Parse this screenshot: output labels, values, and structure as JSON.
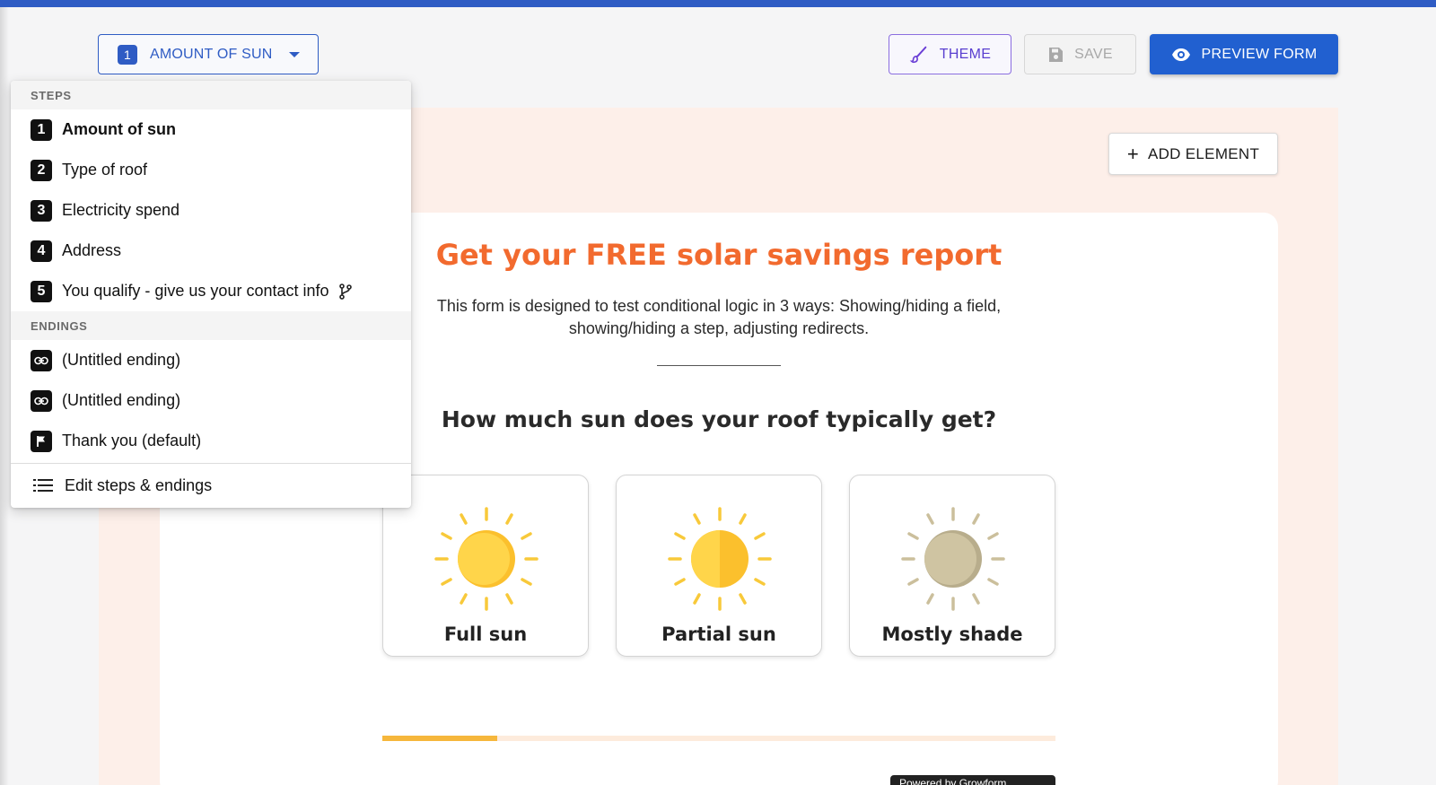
{
  "header": {
    "step_selector": {
      "number": "1",
      "label": "AMOUNT OF SUN"
    },
    "theme_label": "THEME",
    "save_label": "SAVE",
    "preview_label": "PREVIEW FORM",
    "icons": {
      "theme": "brush-icon",
      "save": "floppy-disk-icon",
      "preview": "eye-icon",
      "caret": "caret-down-icon"
    }
  },
  "colors": {
    "brand_blue": "#2f5cc4",
    "title_orange": "#f26a2e",
    "canvas_bg": "#fdefe9",
    "progress": "#f6b73c"
  },
  "menu": {
    "steps_header": "STEPS",
    "steps": [
      {
        "number": "1",
        "label": "Amount of sun",
        "active": true
      },
      {
        "number": "2",
        "label": "Type of roof"
      },
      {
        "number": "3",
        "label": "Electricity spend"
      },
      {
        "number": "4",
        "label": "Address"
      },
      {
        "number": "5",
        "label": "You qualify - give us your contact info",
        "icon": "branch-icon"
      }
    ],
    "endings_header": "ENDINGS",
    "endings": [
      {
        "label": "(Untitled ending)",
        "icon": "link-icon"
      },
      {
        "label": "(Untitled ending)",
        "icon": "link-icon"
      },
      {
        "label": "Thank you (default)",
        "icon": "flag-icon"
      }
    ],
    "edit_label": "Edit steps & endings"
  },
  "canvas": {
    "add_element_label": "ADD ELEMENT",
    "title": "Get your FREE solar savings report",
    "description_line1": "This form is designed to test conditional logic in 3 ways: Showing/hiding a field,",
    "description_line2": "showing/hiding a step, adjusting redirects.",
    "question": "How much sun does your roof typically get?",
    "options": [
      {
        "label": "Full sun",
        "icon": "full-sun-icon"
      },
      {
        "label": "Partial sun",
        "icon": "partial-sun-icon"
      },
      {
        "label": "Mostly shade",
        "icon": "shade-sun-icon"
      }
    ],
    "progress_fraction": 0.17,
    "powered_by": "Powered by Growform"
  }
}
